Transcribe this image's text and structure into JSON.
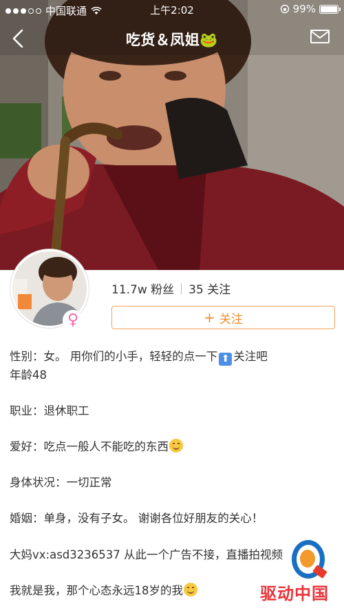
{
  "status_bar": {
    "carrier": "中国联通",
    "time": "上午2:02",
    "battery": "99%",
    "battery_level": 0.99
  },
  "nav": {
    "title": "吃货＆凤姐🐸",
    "back_icon": "chevron-left-icon",
    "mail_icon": "mail-icon"
  },
  "profile": {
    "followers": "11.7w 粉丝",
    "following": "35 关注",
    "follow_label": "关注",
    "gender_symbol": "♀"
  },
  "bio": {
    "line1_a": "性别：女。 用你们的小手，轻轻的点一下",
    "line1_b": "关注吧",
    "line2": "年龄48",
    "line3": "职业：退休职工",
    "line4": "爱好：吃点一般人不能吃的东西",
    "line5": "身体状况：一切正常",
    "line6": "婚姻：单身，没有子女。        谢谢各位好朋友的关心！",
    "line7": "大妈vx:asd3236537  从此一个广告不接，直播拍视频",
    "line8": "我就是我，那个心态永远18岁的我"
  },
  "watermark": {
    "brand": "驱动中国"
  },
  "colors": {
    "accent": "#f08b2c",
    "follow_border": "#f5a15a",
    "gender_pink": "#f06aa8"
  }
}
